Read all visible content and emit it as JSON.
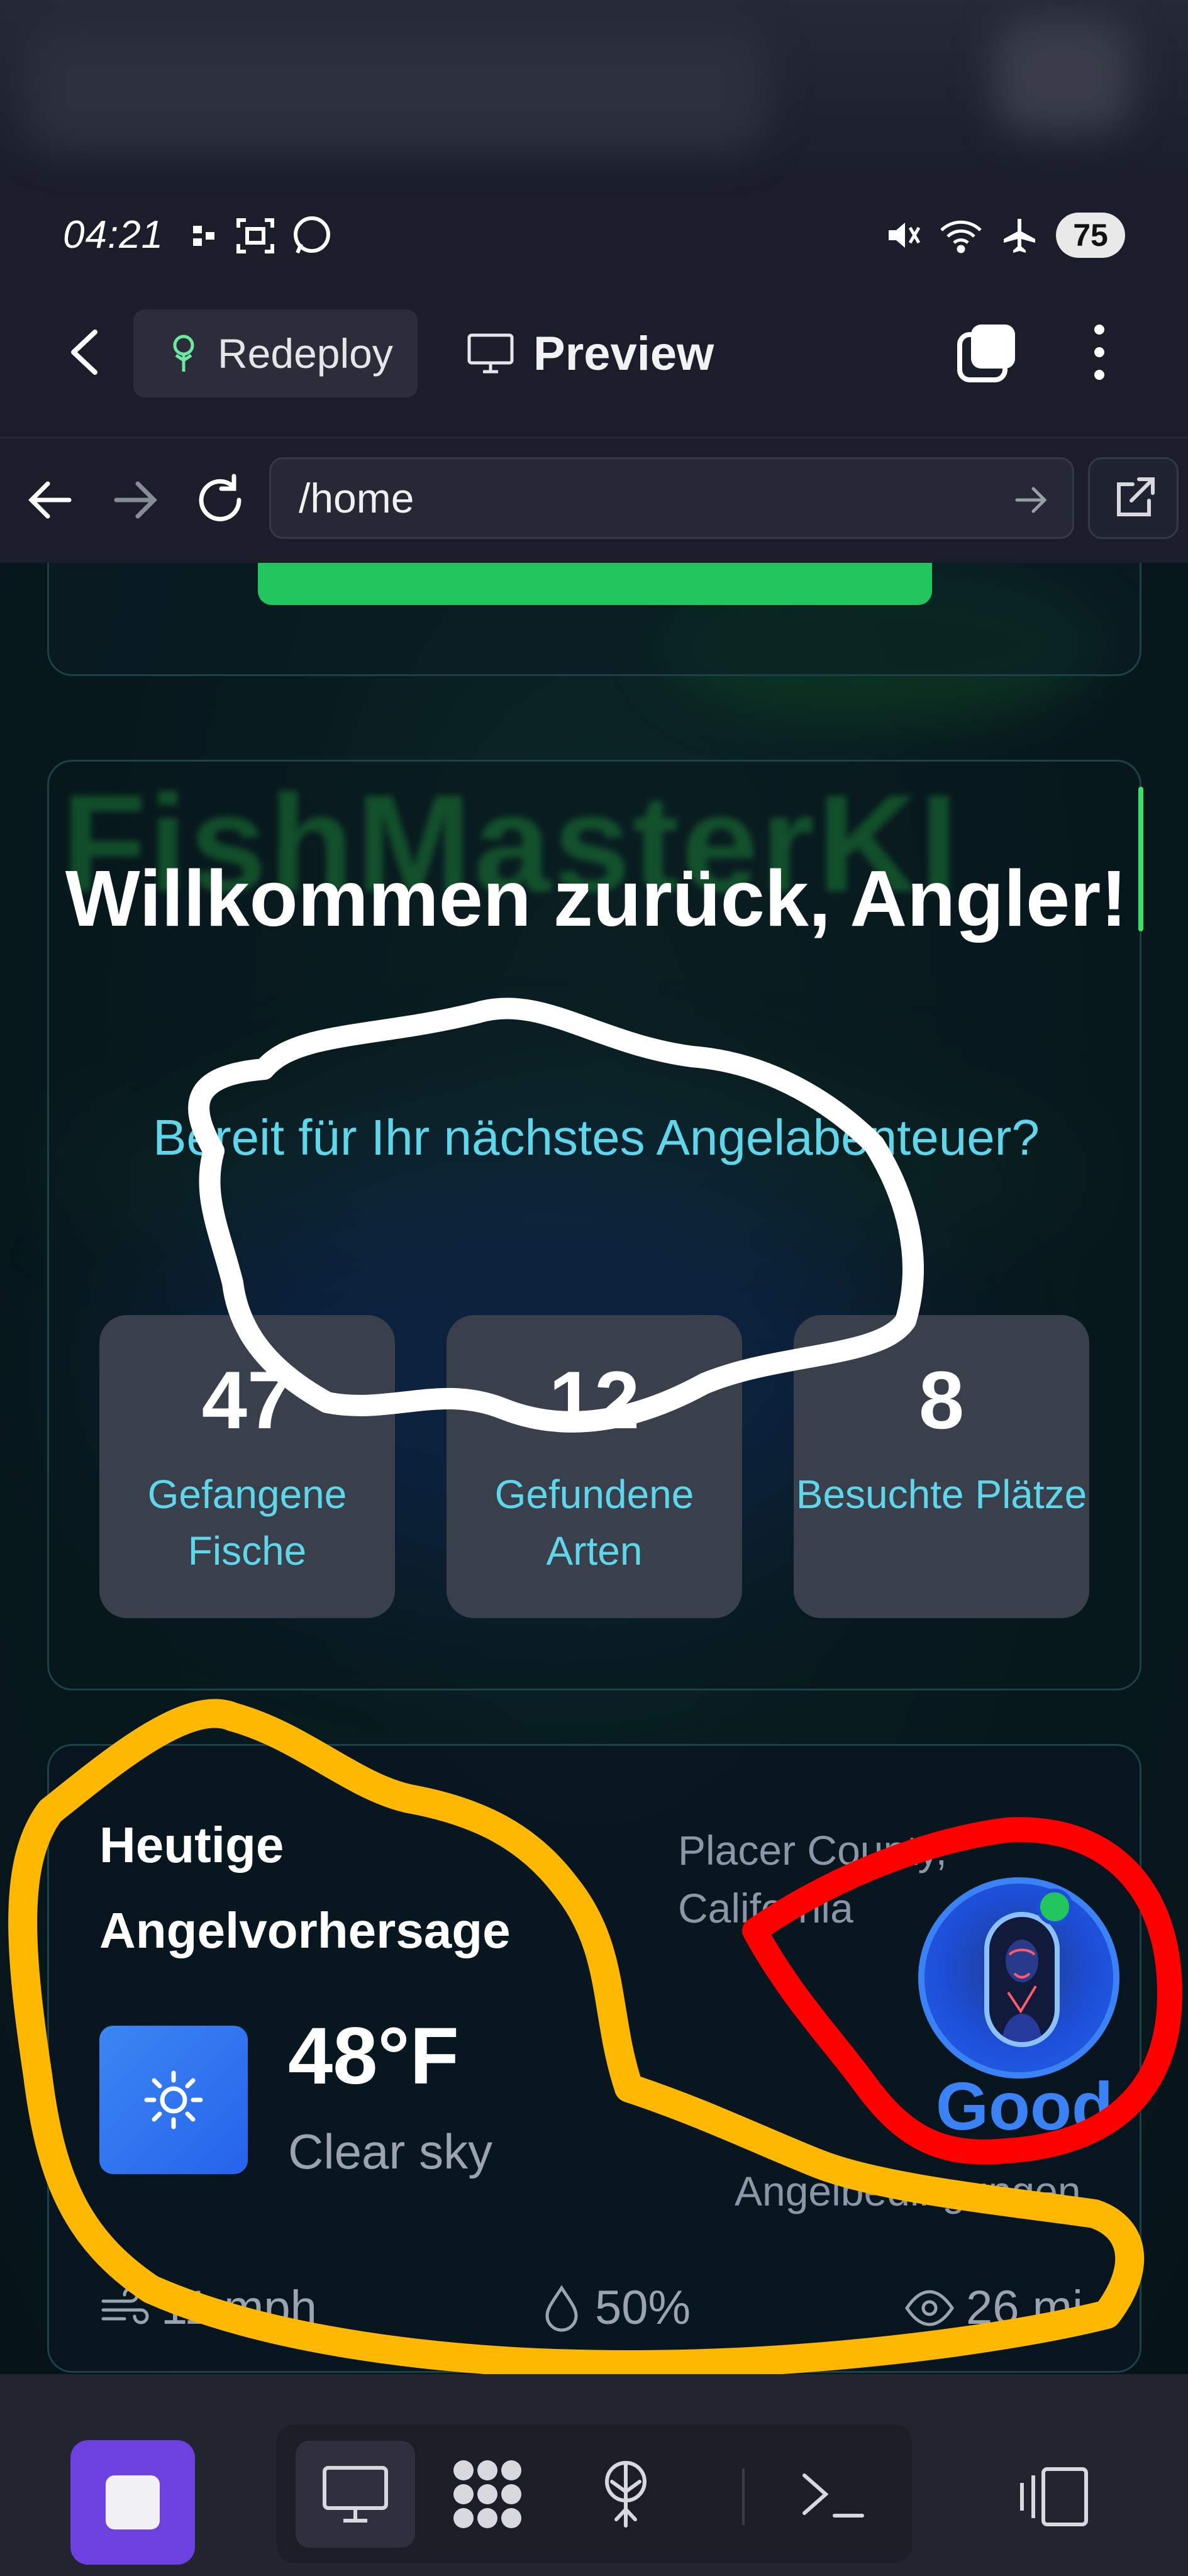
{
  "status_bar": {
    "time": "04:21",
    "battery": "75"
  },
  "app_bar": {
    "redeploy_label": "Redeploy",
    "preview_label": "Preview"
  },
  "browser": {
    "url": "/home"
  },
  "welcome": {
    "watermark": "FishMasterKI",
    "title": "Willkommen zurück, Angler!",
    "subtitle": "Bereit für Ihr nächstes Angelabenteuer?"
  },
  "stats": [
    {
      "value": "47",
      "label": "Gefangene Fische"
    },
    {
      "value": "12",
      "label": "Gefundene Arten"
    },
    {
      "value": "8",
      "label": "Besuchte Plätze"
    }
  ],
  "weather": {
    "title": "Heutige Angelvorhersage",
    "location": "Placer County, California",
    "temperature": "48°F",
    "condition": "Clear sky",
    "rating": "Good",
    "rating_label": "Angelbedingungen",
    "wind": "11 mph",
    "humidity": "50%",
    "visibility": "26 mi"
  },
  "colors": {
    "accent_cyan": "#5fd6ea",
    "cta_green": "#22c55e",
    "stop_purple": "#6d40e0",
    "weather_blue": "#3b82f6",
    "annotation_white": "#ffffff",
    "annotation_yellow": "#ffb800",
    "annotation_red": "#ff0000"
  },
  "icons": {
    "back": "chevron-left-icon",
    "redeploy": "network-tree-icon",
    "preview": "monitor-icon",
    "tabs": "tabs-icon",
    "more": "more-vertical-icon",
    "nav_back": "arrow-left-icon",
    "nav_forward": "arrow-right-icon",
    "reload": "reload-icon",
    "external": "external-link-icon",
    "sun": "sun-icon",
    "wind": "wind-icon",
    "humidity": "droplet-icon",
    "visibility": "eye-icon"
  }
}
